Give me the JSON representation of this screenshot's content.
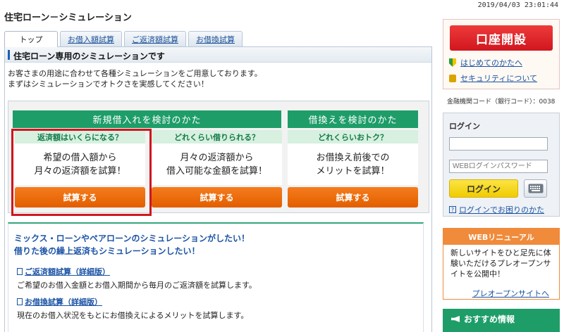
{
  "timestamp": "2019/04/03 23:01:44",
  "page_title": "住宅ローン－シミュレーション",
  "tabs": [
    {
      "label": "トップ",
      "active": true
    },
    {
      "label": "お借入額試算",
      "active": false
    },
    {
      "label": "ご返済額試算",
      "active": false
    },
    {
      "label": "お借換試算",
      "active": false
    }
  ],
  "section_heading": "住宅ローン専用のシミュレーションです",
  "intro": {
    "line1": "お客さまの用途に合わせて各種シミュレーションをご用意しております。",
    "line2": "まずはシミュレーションでオトクさを実感してください！"
  },
  "groups": {
    "new": "新規借入れを検討のかた",
    "refinance": "借換えを検討のかた"
  },
  "cards": [
    {
      "subtitle": "返済額はいくらになる？",
      "desc1": "希望の借入額から",
      "desc2": "月々の返済額を試算！",
      "button": "試算する"
    },
    {
      "subtitle": "どれくらい借りられる？",
      "desc1": "月々の返済額から",
      "desc2": "借入可能な金額を試算！",
      "button": "試算する"
    },
    {
      "subtitle": "どれくらいおトク？",
      "desc1": "お借換え前後での",
      "desc2": "メリットを試算！",
      "button": "試算する"
    }
  ],
  "more": {
    "lead1": "ミックス・ローンやペアローンのシミュレーションがしたい！",
    "lead2": "借りた後の繰上返済もシミュレーションしたい！",
    "links": [
      {
        "label": "ご返済額試算（詳細版）",
        "desc": "ご希望のお借入金額とお借入期間から毎月のご返済額を試算します。"
      },
      {
        "label": "お借換試算（詳細版）",
        "desc": "現在のお借入状況をもとにお借換えによるメリットを試算します。"
      }
    ]
  },
  "sidebar": {
    "open_account": "口座開設",
    "beginner_link": "はじめてのかたへ",
    "security_link": "セキュリティについて",
    "bank_code": "金融機関コード（銀行コード）：0038",
    "login_title": "ログイン",
    "user_placeholder": "",
    "password_placeholder": "WEBログインパスワード",
    "login_button": "ログイン",
    "help_link": "ログインでお困りのかた",
    "renewal_title": "WEBリニューアル",
    "renewal_text": "新しいサイトをひと足先に体験いただけるプレオープンサイトを公開中！",
    "renewal_link": "プレオープンサイトへ",
    "reco_title": "おすすめ情報"
  },
  "colors": {
    "green": "#1e9d69",
    "orange": "#e96a0c",
    "red": "#d0161e",
    "link_blue": "#1b53a5"
  }
}
